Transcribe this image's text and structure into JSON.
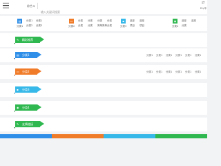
{
  "header": {
    "menu_icon": "hamburger-icon",
    "search_scope": "综合",
    "search_placeholder": "输入关键词搜索",
    "right_icon": "translate-icon",
    "right_label": "En/中"
  },
  "categories": [
    {
      "color": "#2f8fe8",
      "icon_glyph": "▤",
      "icon_name": "grid-icon",
      "label": "分类1",
      "links": [
        "分类1",
        "分类1",
        "分类2",
        "分类3"
      ]
    },
    {
      "color": "#f07c2a",
      "icon_glyph": "▭",
      "icon_name": "monitor-icon",
      "label": "分类2",
      "links": [
        "分类",
        "分类",
        "分类",
        "分类",
        "分类",
        "分类",
        "简单简单",
        "分类"
      ]
    },
    {
      "color": "#36b8e8",
      "icon_glyph": "▪",
      "icon_name": "square-icon",
      "label": "分类3",
      "links": [
        "选择",
        "选择",
        "项目",
        "项目"
      ]
    },
    {
      "color": "#2fb84f",
      "icon_glyph": "◉",
      "icon_name": "circle-icon",
      "label": "分类4",
      "links": [
        "选择",
        "选择",
        "分类"
      ]
    }
  ],
  "sections": [
    {
      "title": "精彩推荐",
      "color": "#2fb84f",
      "dark": "#1e7a33",
      "icon_name": "pin-icon",
      "icon_glyph": "✎",
      "width": 36,
      "links": []
    },
    {
      "title": "分类1",
      "color": "#2f8fe8",
      "dark": "#1c5fa0",
      "icon_name": "grid-icon",
      "icon_glyph": "▤",
      "width": 32,
      "links": [
        "分类1",
        "分类1",
        "分类1",
        "分类1",
        "分类1",
        "分类1"
      ]
    },
    {
      "title": "分类2",
      "color": "#f07c2a",
      "dark": "#a8521a",
      "icon_name": "monitor-icon",
      "icon_glyph": "▭",
      "width": 32,
      "links": [
        "分类1",
        "分类1",
        "分类1",
        "分类1",
        "分类1",
        "分类1"
      ]
    },
    {
      "title": "分类3",
      "color": "#36b8e8",
      "dark": "#217ea0",
      "icon_name": "square-icon",
      "icon_glyph": "▪",
      "width": 32,
      "links": []
    },
    {
      "title": "分类4",
      "color": "#2fb84f",
      "dark": "#1e7a33",
      "icon_name": "circle-icon",
      "icon_glyph": "◉",
      "width": 32,
      "links": []
    },
    {
      "title": "友情链接",
      "color": "#2fb84f",
      "dark": "#1e7a33",
      "icon_name": "link-icon",
      "icon_glyph": "✎",
      "width": 36,
      "links": []
    }
  ],
  "bottom_colors": [
    "#2f8fe8",
    "#f07c2a",
    "#36b8e8",
    "#2fb84f"
  ]
}
